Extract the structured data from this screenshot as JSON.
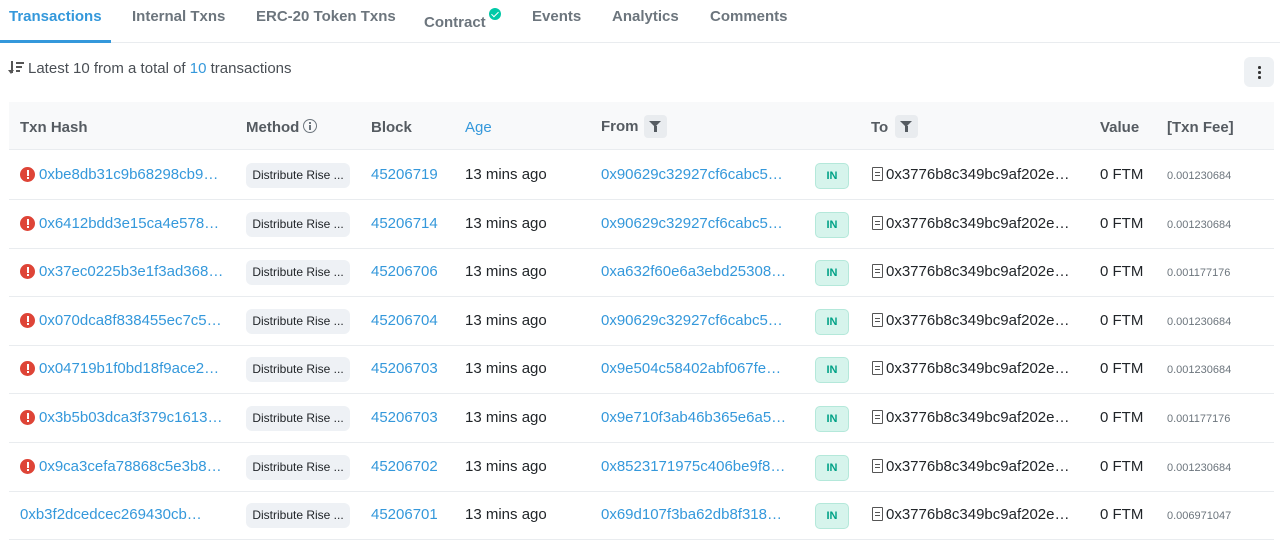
{
  "tabs": [
    {
      "label": "Transactions",
      "active": true
    },
    {
      "label": "Internal Txns"
    },
    {
      "label": "ERC-20 Token Txns"
    },
    {
      "label": "Contract",
      "verified_icon": "check-circle-icon"
    },
    {
      "label": "Events"
    },
    {
      "label": "Analytics"
    },
    {
      "label": "Comments"
    }
  ],
  "summary": {
    "prefix": "Latest 10 from a total of",
    "count": "10",
    "suffix": "transactions"
  },
  "table": {
    "headers": {
      "txn_hash": "Txn Hash",
      "method": "Method",
      "block": "Block",
      "age": "Age",
      "from": "From",
      "to": "To",
      "value": "Value",
      "txn_fee": "[Txn Fee]"
    },
    "rows": [
      {
        "hash": "0xbe8db31c9b68298cb9…",
        "failed": true,
        "method": "Distribute Rise ...",
        "block": "45206719",
        "age": "13 mins ago",
        "from": "0x90629c32927cf6cabc5…",
        "direction": "IN",
        "to": "0x3776b8c349bc9af202e…",
        "value": "0 FTM",
        "fee": "0.001230684"
      },
      {
        "hash": "0x6412bdd3e15ca4e578…",
        "failed": true,
        "method": "Distribute Rise ...",
        "block": "45206714",
        "age": "13 mins ago",
        "from": "0x90629c32927cf6cabc5…",
        "direction": "IN",
        "to": "0x3776b8c349bc9af202e…",
        "value": "0 FTM",
        "fee": "0.001230684"
      },
      {
        "hash": "0x37ec0225b3e1f3ad368…",
        "failed": true,
        "method": "Distribute Rise ...",
        "block": "45206706",
        "age": "13 mins ago",
        "from": "0xa632f60e6a3ebd25308…",
        "direction": "IN",
        "to": "0x3776b8c349bc9af202e…",
        "value": "0 FTM",
        "fee": "0.001177176"
      },
      {
        "hash": "0x070dca8f838455ec7c5…",
        "failed": true,
        "method": "Distribute Rise ...",
        "block": "45206704",
        "age": "13 mins ago",
        "from": "0x90629c32927cf6cabc5…",
        "direction": "IN",
        "to": "0x3776b8c349bc9af202e…",
        "value": "0 FTM",
        "fee": "0.001230684"
      },
      {
        "hash": "0x04719b1f0bd18f9ace2…",
        "failed": true,
        "method": "Distribute Rise ...",
        "block": "45206703",
        "age": "13 mins ago",
        "from": "0x9e504c58402abf067fe…",
        "direction": "IN",
        "to": "0x3776b8c349bc9af202e…",
        "value": "0 FTM",
        "fee": "0.001230684"
      },
      {
        "hash": "0x3b5b03dca3f379c1613…",
        "failed": true,
        "method": "Distribute Rise ...",
        "block": "45206703",
        "age": "13 mins ago",
        "from": "0x9e710f3ab46b365e6a5…",
        "direction": "IN",
        "to": "0x3776b8c349bc9af202e…",
        "value": "0 FTM",
        "fee": "0.001177176"
      },
      {
        "hash": "0x9ca3cefa78868c5e3b8…",
        "failed": true,
        "method": "Distribute Rise ...",
        "block": "45206702",
        "age": "13 mins ago",
        "from": "0x8523171975c406be9f8…",
        "direction": "IN",
        "to": "0x3776b8c349bc9af202e…",
        "value": "0 FTM",
        "fee": "0.001230684"
      },
      {
        "hash": "0xb3f2dcedcec269430cb…",
        "failed": false,
        "method": "Distribute Rise ...",
        "block": "45206701",
        "age": "13 mins ago",
        "from": "0x69d107f3ba62db8f318…",
        "direction": "IN",
        "to": "0x3776b8c349bc9af202e…",
        "value": "0 FTM",
        "fee": "0.006971047"
      }
    ]
  },
  "colors": {
    "accent": "#3498db",
    "error": "#de4437",
    "in_badge": "#00a186"
  }
}
